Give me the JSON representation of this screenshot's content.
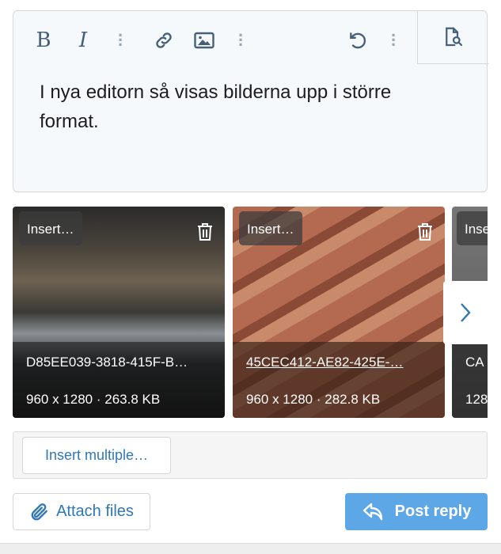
{
  "toolbar": {
    "bold": "B",
    "italic": "I"
  },
  "editor": {
    "content": "I nya editorn så visas bilderna upp i större format."
  },
  "attachments": [
    {
      "insert_label": "Insert…",
      "filename": "D85EE039-3818-415F-B…",
      "meta": "960 x 1280 · 263.8 KB"
    },
    {
      "insert_label": "Insert…",
      "filename": "45CEC412-AE82-425E-…",
      "meta": "960 x 1280 · 282.8 KB"
    },
    {
      "insert_label": "Inse",
      "filename": "CA",
      "meta": "128"
    }
  ],
  "insert_multiple": "Insert multiple…",
  "attach_files": "Attach files",
  "post_reply": "Post reply",
  "colors": {
    "accent": "#5ea7e6",
    "link": "#2f77b8",
    "toolbar_icon": "#47607a"
  }
}
